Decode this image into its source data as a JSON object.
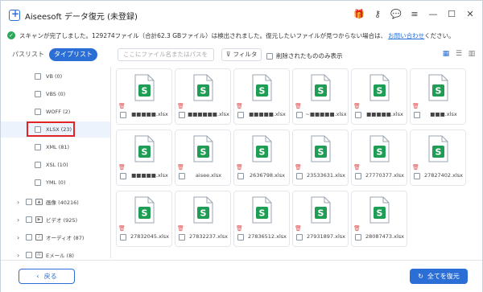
{
  "app": {
    "title": "Aiseesoft データ復元 (未登録)"
  },
  "status": {
    "message": "スキャンが完了しました。129274ファイル（合計62.3 GBファイル）は検出されました。復元したいファイルが見つからない場合は、",
    "contact_link": "お問い合わせ",
    "suffix": "ください。"
  },
  "tabs": [
    {
      "label": "パスリスト",
      "active": false
    },
    {
      "label": "タイプリスト",
      "active": true
    }
  ],
  "search": {
    "placeholder": "ここにファイル名またはパスを"
  },
  "filter_label": "フィルタ",
  "deleted_only_label": "削除されたもののみ表示",
  "sidebar": {
    "children": [
      {
        "label": "VB (0)"
      },
      {
        "label": "VBS (0)"
      },
      {
        "label": "WOFF (2)"
      },
      {
        "label": "XLSX (23)",
        "selected": true
      },
      {
        "label": "XML (81)"
      },
      {
        "label": "XSL (10)"
      },
      {
        "label": "YML (0)"
      }
    ],
    "categories": [
      {
        "label": "画像 (40216)",
        "icon": "image-icon"
      },
      {
        "label": "ビデオ (925)",
        "icon": "video-icon"
      },
      {
        "label": "オーディオ (87)",
        "icon": "audio-icon"
      },
      {
        "label": "Eメール (8)",
        "icon": "email-icon"
      }
    ]
  },
  "files": [
    {
      "name": "■■■■■.xlsx"
    },
    {
      "name": "■■■■■■.xlsx"
    },
    {
      "name": "■■■■■.xlsx"
    },
    {
      "name": "~■■■■■.xlsx"
    },
    {
      "name": "■■■■■.xlsx"
    },
    {
      "name": "■■■.xlsx"
    },
    {
      "name": "■■■■■.xlsx"
    },
    {
      "name": "aisee.xlsx"
    },
    {
      "name": "2636798.xlsx"
    },
    {
      "name": "23533631.xlsx"
    },
    {
      "name": "27770377.xlsx"
    },
    {
      "name": "27827402.xlsx"
    },
    {
      "name": "27832045.xlsx"
    },
    {
      "name": "27832237.xlsx"
    },
    {
      "name": "27836512.xlsx"
    },
    {
      "name": "27931897.xlsx"
    },
    {
      "name": "28087473.xlsx"
    }
  ],
  "buttons": {
    "back": "戻る",
    "restore_all": "全てを復元"
  },
  "colors": {
    "accent": "#2b6fd6",
    "excel_green": "#1f9d55",
    "highlight_red": "#e02424"
  }
}
